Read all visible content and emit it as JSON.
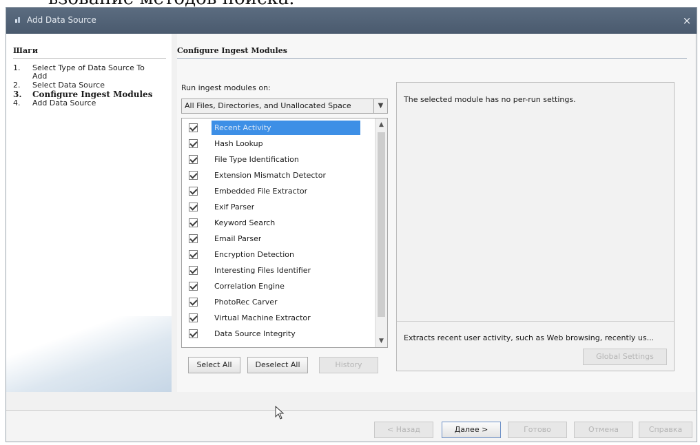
{
  "clipped_text": "ьзование методов поиска.",
  "window": {
    "title": "Add Data Source",
    "close_label": "×"
  },
  "steps": {
    "title": "Шаги",
    "items": [
      {
        "num": "1.",
        "label": "Select Type of Data Source To Add"
      },
      {
        "num": "2.",
        "label": "Select Data Source"
      },
      {
        "num": "3.",
        "label": "Configure Ingest Modules"
      },
      {
        "num": "4.",
        "label": "Add Data Source"
      }
    ]
  },
  "main": {
    "title": "Configure Ingest Modules",
    "run_label": "Run ingest modules on:",
    "run_on_value": "All Files, Directories, and Unallocated Space",
    "modules": [
      "Recent Activity",
      "Hash Lookup",
      "File Type Identification",
      "Extension Mismatch Detector",
      "Embedded File Extractor",
      "Exif Parser",
      "Keyword Search",
      "Email Parser",
      "Encryption Detection",
      "Interesting Files Identifier",
      "Correlation Engine",
      "PhotoRec Carver",
      "Virtual Machine Extractor",
      "Data Source Integrity"
    ],
    "select_all": "Select All",
    "deselect_all": "Deselect All",
    "history": "History",
    "settings_msg": "The selected module has no per-run settings.",
    "module_desc": "Extracts recent user activity, such as Web browsing, recently us...",
    "global_settings": "Global Settings"
  },
  "footer": {
    "back": "< Назад",
    "next": "Далее >",
    "finish": "Готово",
    "cancel": "Отмена",
    "help": "Справка"
  }
}
